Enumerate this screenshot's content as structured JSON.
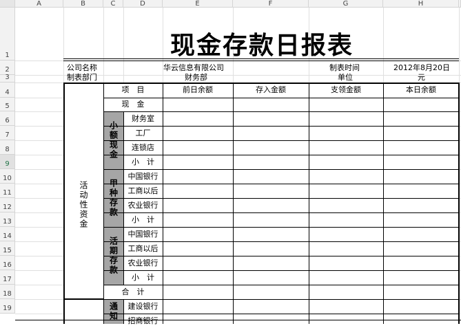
{
  "columns": [
    "A",
    "B",
    "C",
    "D",
    "E",
    "F",
    "G",
    "H"
  ],
  "rows": [
    "1",
    "2",
    "3",
    "4",
    "5",
    "6",
    "7",
    "8",
    "9",
    "10",
    "11",
    "12",
    "13",
    "14",
    "15",
    "16",
    "17",
    "18",
    "19"
  ],
  "title": "现金存款日报表",
  "info": {
    "company_label": "公司名称",
    "company_value": "华云信息有限公司",
    "dept_label": "制表部门",
    "dept_value": "财务部",
    "time_label": "制表时间",
    "time_value": "2012年8月20日",
    "unit_label": "单位",
    "unit_value": "元"
  },
  "table": {
    "header_item": "项　目",
    "col_prev": "前日余额",
    "col_deposit": "存入金额",
    "col_withdraw": "支领金额",
    "col_today": "本日余额",
    "group_main": "活动性资金",
    "cash": "现　金",
    "petty_group": "小额现金",
    "petty_items": [
      "财务室",
      "工厂",
      "连锁店",
      "小　计"
    ],
    "a_group": "甲种存款",
    "a_items": [
      "中国银行",
      "工商以后",
      "农业银行",
      "小　计"
    ],
    "d_group": "活期存款",
    "d_items": [
      "中国银行",
      "工商以后",
      "农业银行",
      "小　计"
    ],
    "total": "合　计",
    "notice_group": "通知",
    "notice_items": [
      "建设银行",
      "招商银行"
    ]
  }
}
